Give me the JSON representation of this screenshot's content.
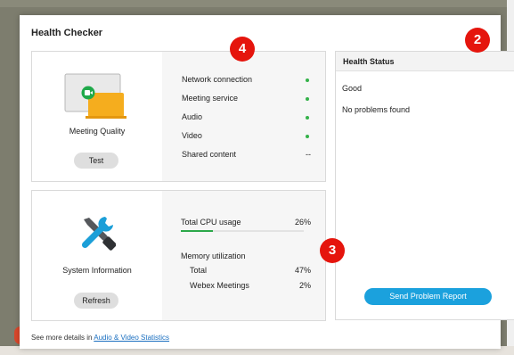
{
  "window": {
    "title": "Health Checker"
  },
  "meeting_quality": {
    "label": "Meeting Quality",
    "button": "Test",
    "rows": [
      {
        "name": "Network connection",
        "status": "ok"
      },
      {
        "name": "Meeting service",
        "status": "ok"
      },
      {
        "name": "Audio",
        "status": "ok"
      },
      {
        "name": "Video",
        "status": "ok"
      },
      {
        "name": "Shared content",
        "status": "--"
      }
    ]
  },
  "system_info": {
    "label": "System Information",
    "button": "Refresh",
    "cpu_label": "Total CPU usage",
    "cpu_value": "26%",
    "cpu_percent": 26,
    "memory_label": "Memory utilization",
    "memory_total_label": "Total",
    "memory_total_value": "47%",
    "memory_webex_label": "Webex Meetings",
    "memory_webex_value": "2%"
  },
  "health_status": {
    "header": "Health Status",
    "line1": "Good",
    "line2": "No problems found",
    "report_button": "Send Problem Report"
  },
  "footer": {
    "prefix": "See more details in ",
    "link": "Audio & Video Statistics"
  },
  "badges": {
    "b4": "4",
    "b2": "2",
    "b3": "3"
  },
  "colors": {
    "accent": "#1ba1dd",
    "ok": "#35b24a",
    "badge": "#e5150d"
  }
}
